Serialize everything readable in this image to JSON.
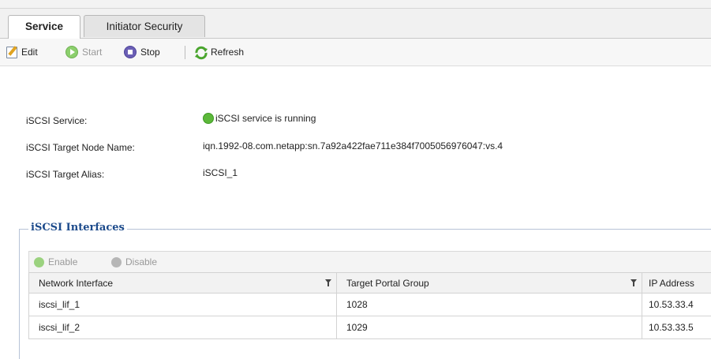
{
  "tabs": [
    {
      "label": "Service",
      "active": true
    },
    {
      "label": "Initiator Security",
      "active": false
    }
  ],
  "toolbar": {
    "edit": {
      "label": "Edit",
      "icon": "edit-icon",
      "enabled": true
    },
    "start": {
      "label": "Start",
      "icon": "start-icon",
      "enabled": false
    },
    "stop": {
      "label": "Stop",
      "icon": "stop-icon",
      "enabled": true
    },
    "refresh": {
      "label": "Refresh",
      "icon": "refresh-icon",
      "enabled": true
    }
  },
  "details": {
    "service_label": "iSCSI Service:",
    "service_value": "iSCSI service is running",
    "service_status_color": "#5cb83a",
    "node_name_label": "iSCSI Target Node Name:",
    "node_name_value": "iqn.1992-08.com.netapp:sn.7a92a422fae711e384f7005056976047:vs.4",
    "alias_label": "iSCSI Target Alias:",
    "alias_value": "iSCSI_1"
  },
  "interfaces": {
    "title": "iSCSI Interfaces",
    "enable_label": "Enable",
    "disable_label": "Disable",
    "columns": [
      "Network Interface",
      "Target Portal Group",
      "IP Address"
    ],
    "rows": [
      [
        "iscsi_lif_1",
        "1028",
        "10.53.33.4"
      ],
      [
        "iscsi_lif_2",
        "1029",
        "10.53.33.5"
      ]
    ]
  },
  "colors": {
    "group_title": "#1c4a8b",
    "start_icon": "#8ccf6d",
    "stop_icon": "#6b5fb5",
    "refresh_icon": "#4aa52e"
  }
}
